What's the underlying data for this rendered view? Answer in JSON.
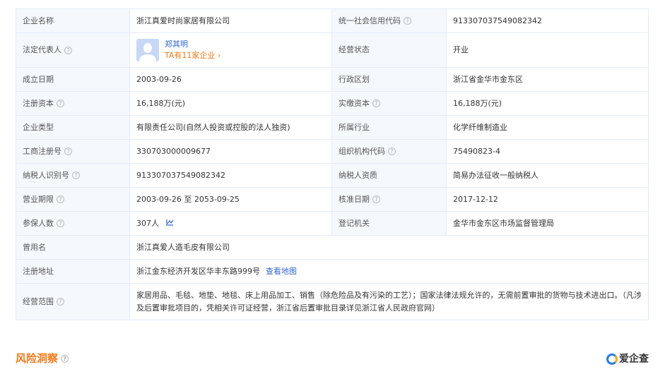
{
  "rows": [
    {
      "l1": "企业名称",
      "v1": "浙江真爱时尚家居有限公司",
      "l2": "统一社会信用代码",
      "v2": "913307037549082342"
    },
    {
      "l1": "法定代表人",
      "l2": "经营状态",
      "v2": "开业"
    },
    {
      "l1": "成立日期",
      "v1": "2003-09-26",
      "l2": "行政区划",
      "v2": "浙江省金华市金东区"
    },
    {
      "l1": "注册资本",
      "v1": "16,188万(元)",
      "l2": "实缴资本",
      "v2": "16,188万(元)"
    },
    {
      "l1": "企业类型",
      "v1": "有限责任公司(自然人投资或控股的法人独资)",
      "l2": "所属行业",
      "v2": "化学纤维制造业"
    },
    {
      "l1": "工商注册号",
      "v1": "330703000009677",
      "l2": "组织机构代码",
      "v2": "75490823-4"
    },
    {
      "l1": "纳税人识别号",
      "v1": "913307037549082342",
      "l2": "纳税人资质",
      "v2": "简易办法征收一般纳税人"
    },
    {
      "l1": "营业期限",
      "v1": "2003-09-26 至 2053-09-25",
      "l2": "核准日期",
      "v2": "2017-12-12"
    },
    {
      "l1": "参保人数",
      "v1": "307人",
      "l2": "登记机关",
      "v2": "金华市金东区市场监督管理局"
    },
    {
      "l1": "曾用名",
      "v1": "浙江真爱人造毛皮有限公司"
    },
    {
      "l1": "注册地址",
      "v1": "浙江金东经济开发区华丰东路999号",
      "link": "查看地图"
    },
    {
      "l1": "经营范围",
      "v1": "家居用品、毛毯、地垫、地毯、床上用品加工、销售（除危险品及有污染的工艺）；国家法律法规允许的，无需前置审批的货物与技术进出口。（凡涉及后置审批项目的，凭相关许可证经营，浙江省后置审批目录详见浙江省人民政府官网）"
    }
  ],
  "legal_rep": {
    "name": "郑其明",
    "companies": "TA有11家企业 ›"
  },
  "section_title": "风险洞察",
  "logo_text": "爱企查",
  "help_glyph": "?",
  "chart_glyph": "📈"
}
